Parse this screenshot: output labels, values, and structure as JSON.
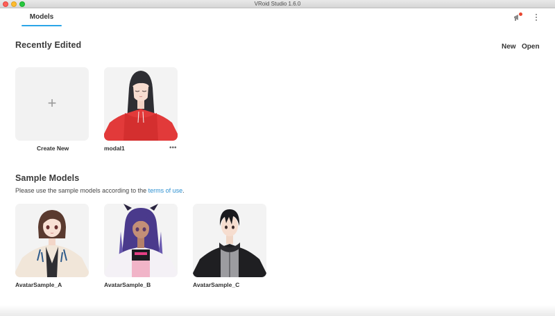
{
  "window": {
    "title": "VRoid Studio 1.6.0"
  },
  "header": {
    "tab_label": "Models"
  },
  "recent": {
    "heading": "Recently Edited",
    "new_label": "New",
    "open_label": "Open",
    "create_label": "Create New",
    "create_glyph": "+",
    "models": [
      {
        "name": "modal1",
        "more": "•••"
      }
    ]
  },
  "samples": {
    "heading": "Sample Models",
    "desc_prefix": "Please use the sample models according to the ",
    "desc_link": "terms of use",
    "desc_suffix": ".",
    "items": [
      {
        "name": "AvatarSample_A"
      },
      {
        "name": "AvatarSample_B"
      },
      {
        "name": "AvatarSample_C"
      }
    ]
  },
  "colors": {
    "accent": "#2aa5e8",
    "link": "#2b8fd0",
    "notification_dot": "#e8452f",
    "card_bg": "#f2f2f2"
  }
}
